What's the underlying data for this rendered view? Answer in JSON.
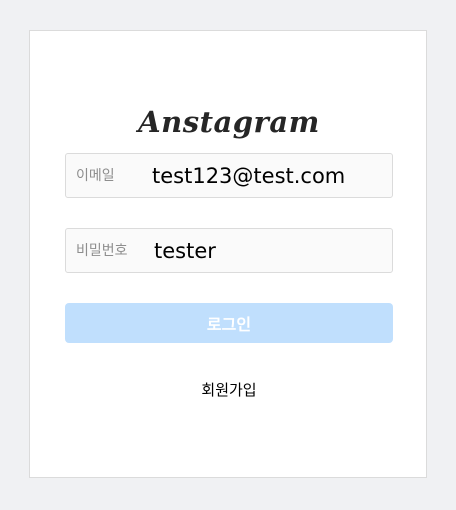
{
  "logo": {
    "text": "Anstagram"
  },
  "form": {
    "email": {
      "label": "이메일",
      "value": "test123@test.com"
    },
    "password": {
      "label": "비밀번호",
      "value": "tester"
    },
    "login_label": "로그인",
    "signup_label": "회원가입"
  },
  "colors": {
    "page_background": "#f0f1f3",
    "card_background": "#ffffff",
    "border": "#dbdbdb",
    "button_disabled": "#c0dffd"
  }
}
